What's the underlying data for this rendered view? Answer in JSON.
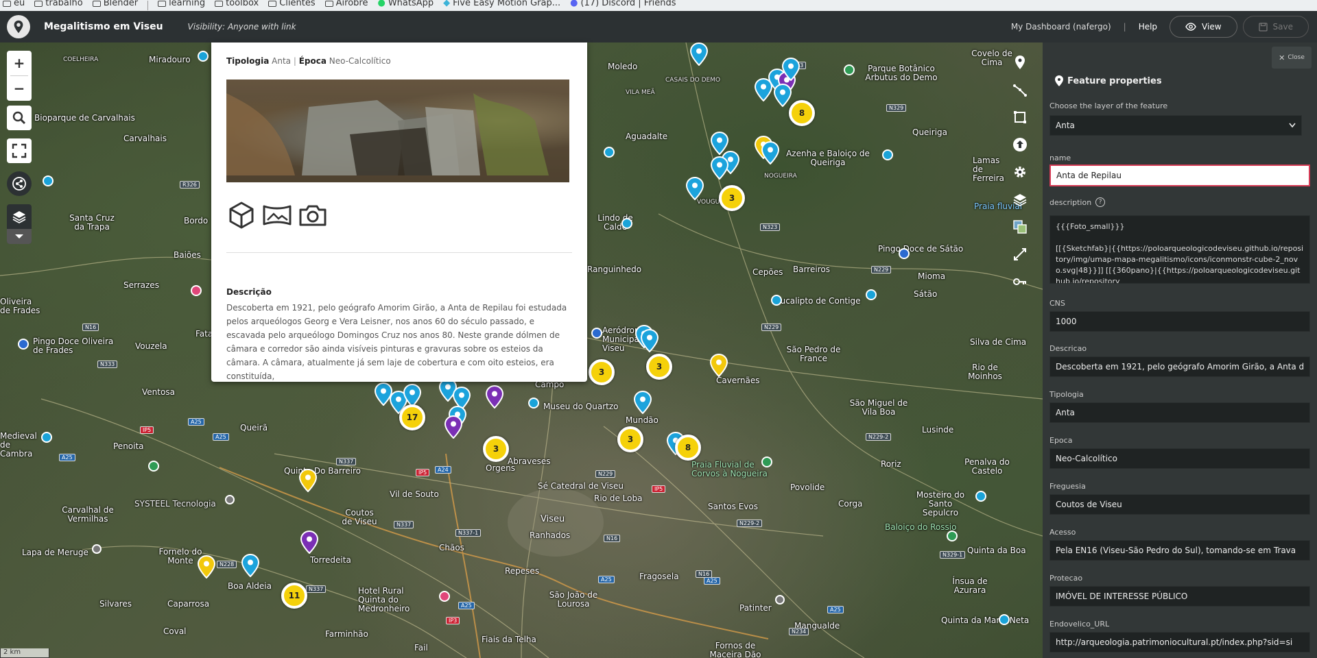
{
  "bookmarks": [
    "eu",
    "trabalho",
    "Blender",
    "learning",
    "toolbox",
    "Clientes",
    "Airobre",
    "WhatsApp",
    "Five Easy Motion Grap...",
    "(17) Discord | Friends"
  ],
  "header": {
    "title": "Megalitismo em Viseu",
    "visibility": "Visibility: Anyone with link",
    "dashboard": "My Dashboard (nafergo)",
    "help": "Help",
    "view": "View",
    "save": "Save"
  },
  "map": {
    "scale": "2 km",
    "places": [
      "Miradouro",
      "COELHEIRA",
      "Bioparque de Carvalhais",
      "Carvalhais",
      "Santa Cruz da Trapa",
      "Bordo",
      "Baiões",
      "Serrazes",
      "Oliveira de Frades",
      "Pingo Doce Oliveira de Frades",
      "Vouzela",
      "Fata",
      "Ventosa",
      "Queirã",
      "Medieval de Cambra",
      "Penoita",
      "Quinta Do Barreiro",
      "SYSTEEL Tecnologia",
      "Carvalhal de Vermilhas",
      "Lapa de Meruge",
      "Fornelo do Monte",
      "Boa Aldeia",
      "Caparrosa",
      "Silvares",
      "Coval",
      "Torredeita",
      "Coutos de Viseu",
      "Vil de Souto",
      "Chãos",
      "Orgens",
      "Abraveses",
      "Museu do Quartzo",
      "Campo",
      "Sé Catedral de Viseu",
      "Viseu",
      "Rio de Loba",
      "Ranhados",
      "Repeses",
      "Hotel Rural Quinta do Medronheiro",
      "São João de Lourosa",
      "Fail",
      "Fiais da Telha",
      "Farminhão",
      "Mundão",
      "Fragosela",
      "Patinter",
      "Santos Evos",
      "Povolide",
      "Corga",
      "Cavernães",
      "São Pedro de France",
      "Aeródromo Municipal de Viseu",
      "Moledo",
      "Aguadalte",
      "Lindo de Calde",
      "Ranguinhedo",
      "Cepões",
      "Barreiros",
      "Pingo Doce de Sátão",
      "Mioma",
      "Sátão",
      "Eucalipto de Contige",
      "Queiriga",
      "Azenha e Baloiço de Queiriga",
      "Parque Botânico Arbutus do Demo",
      "Covelo de Cima",
      "Lamas de Ferreira",
      "Praia fluvial",
      "Silva de Cima",
      "Rio de Moinhos",
      "São Miguel de Vila Boa",
      "Lusinde",
      "Roriz",
      "Penalva do Castelo",
      "Mosteiro do Santo Sepulcro",
      "Baloiço do Rossio",
      "Quinta da Boa",
      "Ínsua de Azurara",
      "Quinta da Maria Neta",
      "Mangualde",
      "Fornos de Maceira Dão",
      "Praia Fluvial de Corvos à Nogueira",
      "VOUGUINHA",
      "NOGUEIRA",
      "VILA MEÃ",
      "CASAIS DO DEMO"
    ],
    "clusters": [
      "8",
      "3",
      "3",
      "3",
      "17",
      "3",
      "3",
      "8",
      "11"
    ],
    "colors": {
      "blue_pin": "#1ca3dc",
      "yellow_pin": "#f2c80c",
      "purple_pin": "#7b2fb5"
    }
  },
  "popup": {
    "tipologia_label": "Tipologia",
    "tipologia_value": "Anta",
    "epoca_label": "Época",
    "epoca_value": "Neo-Calcolítico",
    "desc_heading": "Descrição",
    "desc_text": "Descoberta em 1921, pelo geógrafo Amorim Girão, a Anta de Repilau foi estudada pelos arqueólogos Georg e Vera Leisner, nos anos 60 do século passado, e escavada pelo arqueólogo Domingos Cruz nos anos 80. Neste grande dólmen de câmara e corredor são ainda visíveis pinturas e gravuras sobre os esteios da câmara. A câmara, atualmente já sem laje de cobertura e com oito esteios, era constituída,"
  },
  "panel": {
    "close": "Close",
    "heading": "Feature properties",
    "layer_label": "Choose the layer of the feature",
    "layer_value": "Anta",
    "name_label": "name",
    "name_value": "Anta de Repilau",
    "description_label": "description",
    "description_value": "{{{Foto_small}}}\n\n[[{Sketchfab}|{{https://poloarqueologicodeviseu.github.io/repository/img/umap-mapa-megalitismo/icons/iconmonstr-cube-2_novo.svg|48}}]] [[{360pano}|{{https://poloarqueologicodeviseu.github.io/repository",
    "fields": [
      {
        "label": "CNS",
        "value": "1000"
      },
      {
        "label": "Descricao",
        "value": "Descoberta em 1921, pelo geógrafo Amorim Girão, a Anta d"
      },
      {
        "label": "Tipologia",
        "value": "Anta"
      },
      {
        "label": "Epoca",
        "value": "Neo-Calcolítico"
      },
      {
        "label": "Freguesia",
        "value": "Coutos de Viseu"
      },
      {
        "label": "Acesso",
        "value": "Pela EN16 (Viseu-São Pedro do Sul), tomando-se em Trava"
      },
      {
        "label": "Protecao",
        "value": "IMÓVEL DE INTERESSE PÚBLICO"
      },
      {
        "label": "Endovelico_URL",
        "value": "http://arqueologia.patrimoniocultural.pt/index.php?sid=si"
      }
    ]
  }
}
